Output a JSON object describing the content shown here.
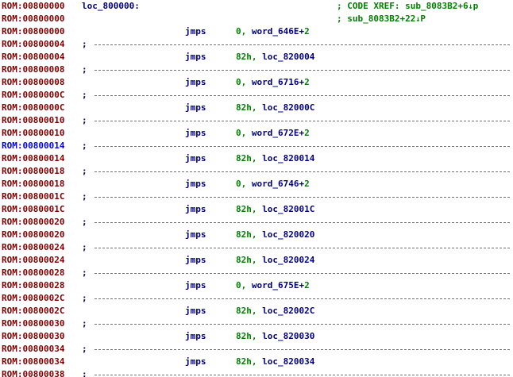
{
  "colors": {
    "address": "#800000",
    "address_current": "#0000ff",
    "code": "#000080",
    "number": "#008000",
    "xref": "#008000",
    "background": "#ffffff"
  },
  "header": {
    "label": "loc_800000:",
    "xrefs": [
      {
        "text": "; CODE XREF: sub_8083B2+6",
        "arrow": "↓",
        "suffix": "p"
      },
      {
        "text": "; sub_8083B2+22",
        "arrow": "↓",
        "suffix": "P"
      }
    ]
  },
  "lines": [
    {
      "kind": "label",
      "addr": "ROM:00800000"
    },
    {
      "kind": "label",
      "addr": "ROM:00800000"
    },
    {
      "kind": "insn",
      "addr": "ROM:00800000",
      "mnem": "jmps",
      "op1": "0, ",
      "op2": "word_646E+",
      "op3": "2"
    },
    {
      "kind": "sep",
      "addr": "ROM:00800004",
      "text": ";"
    },
    {
      "kind": "insn",
      "addr": "ROM:00800004",
      "mnem": "jmps",
      "op1": "82h, ",
      "op2": "loc_820004",
      "op3": ""
    },
    {
      "kind": "sep",
      "addr": "ROM:00800008",
      "text": ";"
    },
    {
      "kind": "insn",
      "addr": "ROM:00800008",
      "mnem": "jmps",
      "op1": "0, ",
      "op2": "word_6716+",
      "op3": "2"
    },
    {
      "kind": "sep",
      "addr": "ROM:0080000C",
      "text": ";"
    },
    {
      "kind": "insn",
      "addr": "ROM:0080000C",
      "mnem": "jmps",
      "op1": "82h, ",
      "op2": "loc_82000C",
      "op3": ""
    },
    {
      "kind": "sep",
      "addr": "ROM:00800010",
      "text": ";"
    },
    {
      "kind": "insn",
      "addr": "ROM:00800010",
      "mnem": "jmps",
      "op1": "0, ",
      "op2": "word_672E+",
      "op3": "2"
    },
    {
      "kind": "sep",
      "addr": "ROM:00800014",
      "text": ";",
      "current": true
    },
    {
      "kind": "insn",
      "addr": "ROM:00800014",
      "mnem": "jmps",
      "op1": "82h, ",
      "op2": "loc_820014",
      "op3": ""
    },
    {
      "kind": "sep",
      "addr": "ROM:00800018",
      "text": ";"
    },
    {
      "kind": "insn",
      "addr": "ROM:00800018",
      "mnem": "jmps",
      "op1": "0, ",
      "op2": "word_6746+",
      "op3": "2"
    },
    {
      "kind": "sep",
      "addr": "ROM:0080001C",
      "text": ";"
    },
    {
      "kind": "insn",
      "addr": "ROM:0080001C",
      "mnem": "jmps",
      "op1": "82h, ",
      "op2": "loc_82001C",
      "op3": ""
    },
    {
      "kind": "sep",
      "addr": "ROM:00800020",
      "text": ";"
    },
    {
      "kind": "insn",
      "addr": "ROM:00800020",
      "mnem": "jmps",
      "op1": "82h, ",
      "op2": "loc_820020",
      "op3": ""
    },
    {
      "kind": "sep",
      "addr": "ROM:00800024",
      "text": ";"
    },
    {
      "kind": "insn",
      "addr": "ROM:00800024",
      "mnem": "jmps",
      "op1": "82h, ",
      "op2": "loc_820024",
      "op3": ""
    },
    {
      "kind": "sep",
      "addr": "ROM:00800028",
      "text": ";"
    },
    {
      "kind": "insn",
      "addr": "ROM:00800028",
      "mnem": "jmps",
      "op1": "0, ",
      "op2": "word_675E+",
      "op3": "2"
    },
    {
      "kind": "sep",
      "addr": "ROM:0080002C",
      "text": ";"
    },
    {
      "kind": "insn",
      "addr": "ROM:0080002C",
      "mnem": "jmps",
      "op1": "82h, ",
      "op2": "loc_82002C",
      "op3": ""
    },
    {
      "kind": "sep",
      "addr": "ROM:00800030",
      "text": ";"
    },
    {
      "kind": "insn",
      "addr": "ROM:00800030",
      "mnem": "jmps",
      "op1": "82h, ",
      "op2": "loc_820030",
      "op3": ""
    },
    {
      "kind": "sep",
      "addr": "ROM:00800034",
      "text": ";"
    },
    {
      "kind": "insn",
      "addr": "ROM:00800034",
      "mnem": "jmps",
      "op1": "82h, ",
      "op2": "loc_820034",
      "op3": ""
    },
    {
      "kind": "sep",
      "addr": "ROM:00800038",
      "text": ";"
    }
  ]
}
